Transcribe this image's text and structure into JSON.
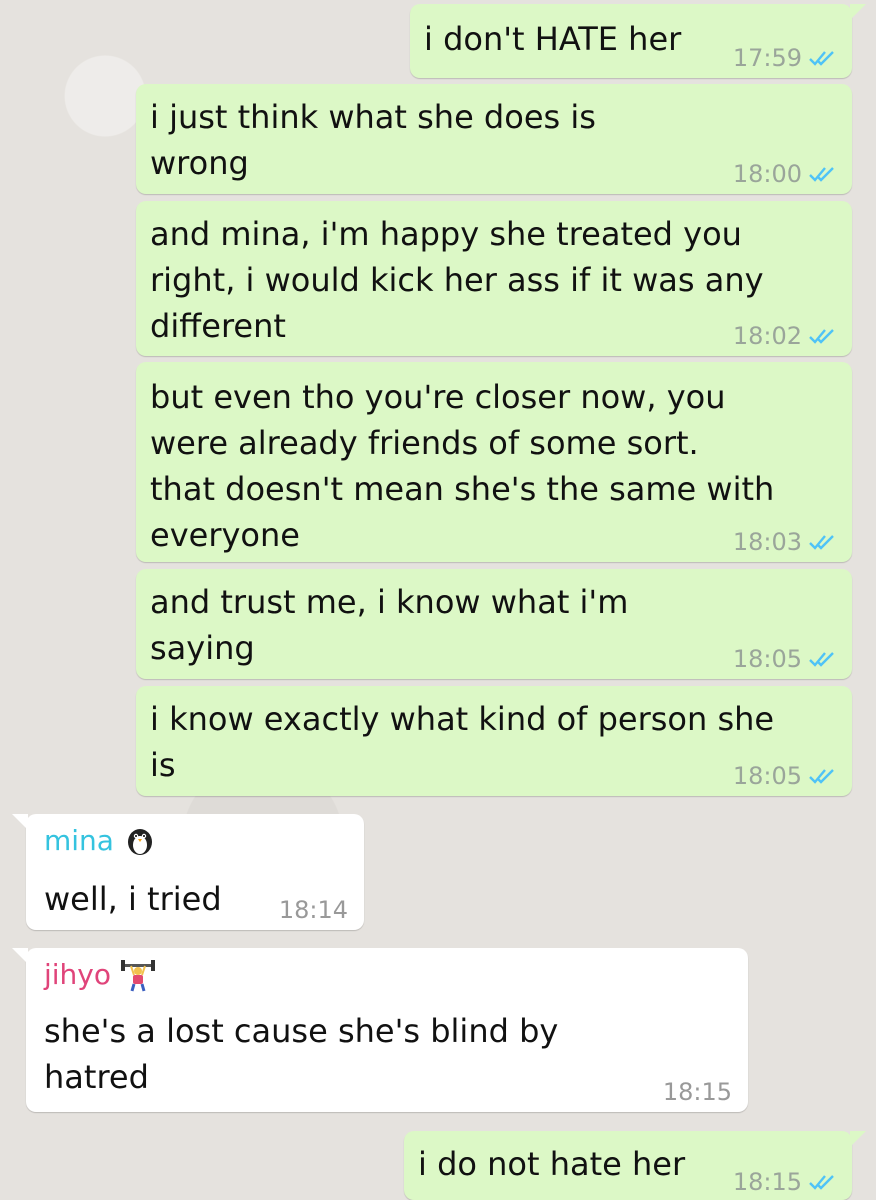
{
  "messages": [
    {
      "text": "i don't HATE her",
      "time": "17:59"
    },
    {
      "text": "i just think what she does is\nwrong",
      "time": "18:00"
    },
    {
      "text": "and mina, i'm happy she treated you\nright, i would kick her ass if it was any\ndifferent",
      "time": "18:02"
    },
    {
      "text": "but even tho you're closer now, you\nwere already friends of some sort.\nthat doesn't mean she's the same with\neveryone",
      "time": "18:03"
    },
    {
      "text": "and trust me, i know what i'm\nsaying",
      "time": "18:05"
    },
    {
      "text": "i know exactly what kind of person she\nis",
      "time": "18:05"
    },
    {
      "sender": "mina",
      "sender_icon": "penguin-icon",
      "text": "well, i tried",
      "time": "18:14"
    },
    {
      "sender": "jihyo",
      "sender_icon": "weightlifter-icon",
      "text": "she's a lost cause she's blind by\nhatred",
      "time": "18:15"
    },
    {
      "text": "i do not hate her",
      "time": "18:15"
    }
  ],
  "colors": {
    "outgoing_bubble": "#dcf8c6",
    "incoming_bubble": "#ffffff",
    "read_ticks": "#4fc3f7",
    "mina_name": "#35c3df",
    "jihyo_name": "#e0447a"
  }
}
